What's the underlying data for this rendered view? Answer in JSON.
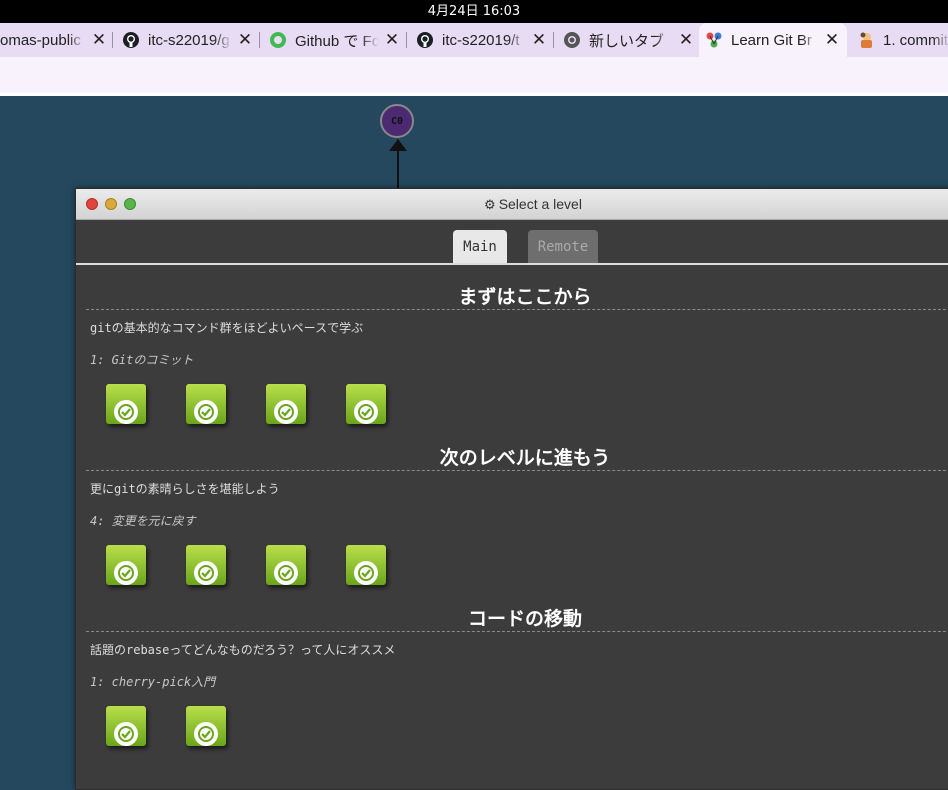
{
  "system": {
    "clock": "4月24日  16:03"
  },
  "browser": {
    "tabs": [
      {
        "title": "omas-public",
        "icon": "favicon-icon",
        "active": false
      },
      {
        "title": "itc-s22019/g",
        "icon": "github-icon",
        "active": false
      },
      {
        "title": "Github で Fo",
        "icon": "green-circle-icon",
        "active": false
      },
      {
        "title": "itc-s22019/t",
        "icon": "github-icon",
        "active": false
      },
      {
        "title": "新しいタブ",
        "icon": "chrome-icon",
        "active": false
      },
      {
        "title": "Learn Git Br",
        "icon": "learngit-icon",
        "active": true
      },
      {
        "title": "1. commit",
        "icon": "character-icon",
        "active": false
      }
    ],
    "close_glyph": "✕"
  },
  "graph": {
    "commit_label": "C0"
  },
  "modal": {
    "title": "Select a level",
    "gear": "⚙",
    "tabs": {
      "main": "Main",
      "remote": "Remote"
    },
    "sections": [
      {
        "title": "まずはここから",
        "description": "gitの基本的なコマンド群をほどよいペースで学ぶ",
        "sublabel": "1: Gitのコミット",
        "levels": 4
      },
      {
        "title": "次のレベルに進もう",
        "description": "更にgitの素晴らしさを堪能しよう",
        "sublabel": "4: 変更を元に戻す",
        "levels": 4
      },
      {
        "title": "コードの移動",
        "description": "話題のrebaseってどんなものだろう？って人にオススメ",
        "sublabel": "1: cherry-pick入門",
        "levels": 2
      }
    ]
  },
  "colors": {
    "background": "#26485f",
    "modal": "#3c3c3c",
    "level_complete": "#8cc434",
    "tab_active": "#f7f2fc"
  }
}
